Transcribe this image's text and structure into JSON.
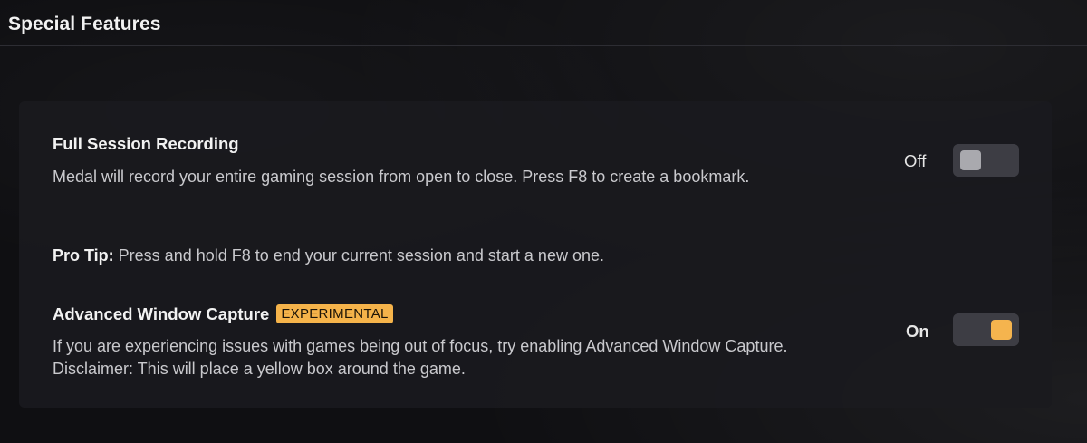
{
  "section": {
    "title": "Special Features"
  },
  "settings": [
    {
      "title": "Full Session Recording",
      "description": "Medal will record your entire gaming session from open to close. Press F8 to create a bookmark.",
      "tip_label": "Pro Tip:",
      "tip_text": " Press and hold F8 to end your current session and start a new one.",
      "state_label": "Off",
      "enabled": false
    },
    {
      "title": "Advanced Window Capture",
      "badge": "EXPERIMENTAL",
      "description": "If you are experiencing issues with games being out of focus, try enabling Advanced Window Capture. Disclaimer: This will place a yellow box around the game.",
      "state_label": "On",
      "enabled": true
    }
  ],
  "colors": {
    "accent": "#f5b44e",
    "toggle_track": "#3d3d44",
    "toggle_knob_off": "#a9a9ae",
    "panel_bg": "#1a1a1f"
  }
}
